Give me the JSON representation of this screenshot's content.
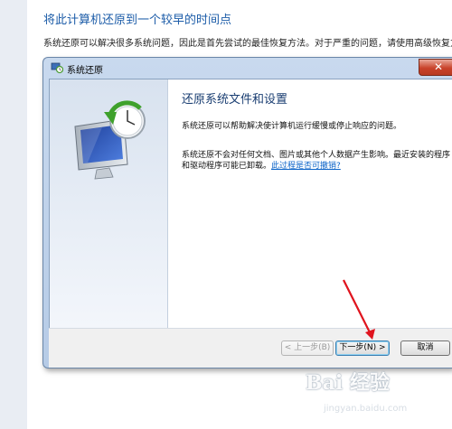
{
  "page": {
    "title": "将此计算机还原到一个较早的时间点",
    "description": "系统还原可以解决很多系统问题，因此是首先尝试的最佳恢复方法。对于严重的问题，请使用高级恢复方法。"
  },
  "dialog": {
    "title": "系统还原",
    "close_glyph": "✕",
    "heading": "还原系统文件和设置",
    "body1": "系统还原可以帮助解决使计算机运行缓慢或停止响应的问题。",
    "body2": "系统还原不会对任何文档、图片或其他个人数据产生影响。最近安装的程序和驱动程序可能已卸载。",
    "link": "此过程是否可撤销?",
    "buttons": {
      "back": "< 上一步(B)",
      "next": "下一步(N) >",
      "cancel": "取消"
    }
  },
  "watermark": {
    "text": "Bai 经验",
    "url": "jingyan.baidu.com"
  },
  "colors": {
    "annotation_arrow": "#e0141e",
    "heading": "#1a3e72",
    "link": "#0b63c8"
  }
}
